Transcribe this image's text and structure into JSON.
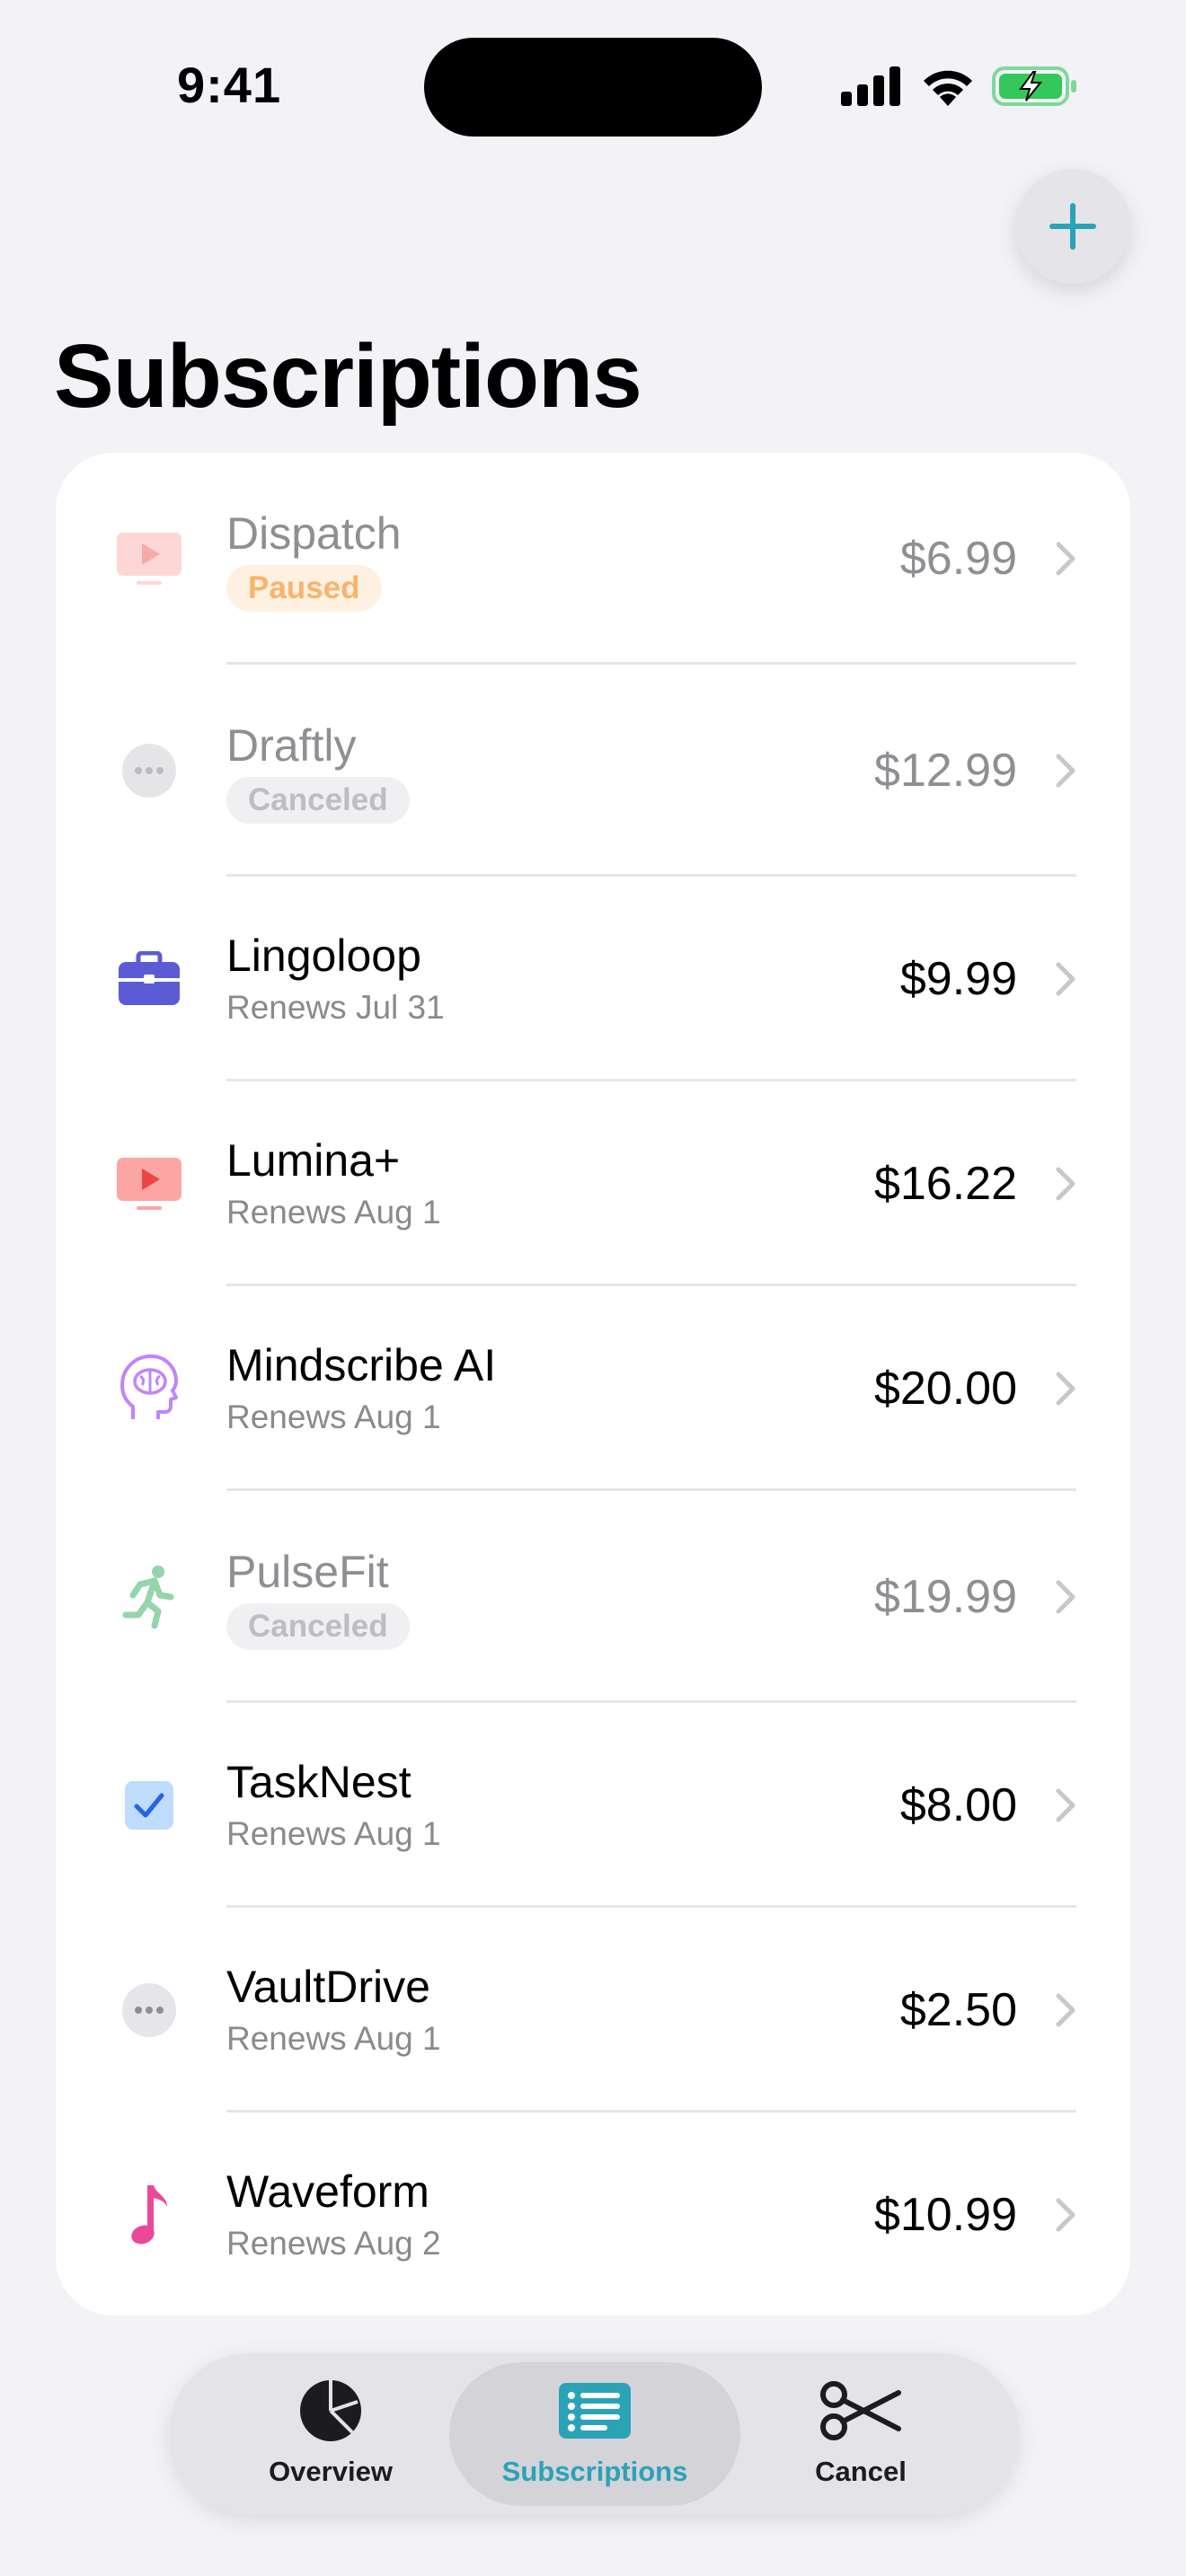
{
  "status_bar": {
    "time": "9:41"
  },
  "header": {
    "title": "Subscriptions",
    "add_icon": "plus-icon"
  },
  "colors": {
    "accent": "#2AA3B7",
    "paused": "#F7B46B",
    "canceled": "#BDBDC2"
  },
  "subscriptions": [
    {
      "name": "Dispatch",
      "status": "Paused",
      "price": "$6.99",
      "icon": "tv-play-icon"
    },
    {
      "name": "Draftly",
      "status": "Canceled",
      "price": "$12.99",
      "icon": "ellipsis-icon"
    },
    {
      "name": "Lingoloop",
      "status": "Renews Jul 31",
      "price": "$9.99",
      "icon": "briefcase-icon"
    },
    {
      "name": "Lumina+",
      "status": "Renews Aug 1",
      "price": "$16.22",
      "icon": "tv-play-icon"
    },
    {
      "name": "Mindscribe AI",
      "status": "Renews Aug 1",
      "price": "$20.00",
      "icon": "brain-head-icon"
    },
    {
      "name": "PulseFit",
      "status": "Canceled",
      "price": "$19.99",
      "icon": "runner-icon"
    },
    {
      "name": "TaskNest",
      "status": "Renews Aug 1",
      "price": "$8.00",
      "icon": "checkbox-icon"
    },
    {
      "name": "VaultDrive",
      "status": "Renews Aug 1",
      "price": "$2.50",
      "icon": "ellipsis-icon"
    },
    {
      "name": "Waveform",
      "status": "Renews Aug 2",
      "price": "$10.99",
      "icon": "music-note-icon"
    }
  ],
  "tabs": [
    {
      "label": "Overview",
      "icon": "pie-chart-icon",
      "active": false
    },
    {
      "label": "Subscriptions",
      "icon": "list-icon",
      "active": true
    },
    {
      "label": "Cancel",
      "icon": "scissors-icon",
      "active": false
    }
  ]
}
